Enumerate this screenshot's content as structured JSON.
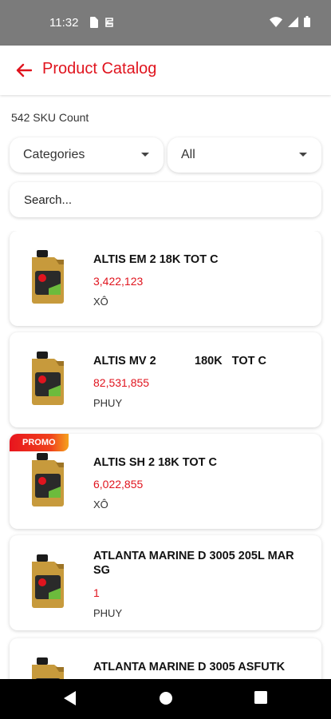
{
  "status": {
    "time": "11:32"
  },
  "header": {
    "title": "Product Catalog"
  },
  "sku_count": "542 SKU Count",
  "filters": {
    "category_label": "Categories",
    "subcategory_label": "All"
  },
  "search": {
    "placeholder": "Search..."
  },
  "products": [
    {
      "name": "ALTIS EM 2 18K TOT C",
      "price": "3,422,123",
      "unit": "XÔ",
      "promo": ""
    },
    {
      "name": "ALTIS MV 2            180K   TOT C",
      "price": "82,531,855",
      "unit": "PHUY",
      "promo": ""
    },
    {
      "name": "ALTIS SH 2 18K TOT C",
      "price": "6,022,855",
      "unit": "XÔ",
      "promo": "PROMO"
    },
    {
      "name": "ATLANTA MARINE D 3005 205L MAR SG",
      "price": "1",
      "unit": "PHUY",
      "promo": ""
    },
    {
      "name": "ATLANTA MARINE D 3005 ASFUTK",
      "price": "",
      "unit": "",
      "promo": ""
    }
  ],
  "colors": {
    "accent": "#e0141e",
    "status_bar": "#7b7b7b"
  },
  "icons": {
    "back": "arrow-left-icon",
    "caret": "caret-down-icon",
    "product": "oil-can-icon",
    "nav_back": "nav-back-icon",
    "nav_home": "nav-home-icon",
    "nav_recents": "nav-recents-icon"
  }
}
